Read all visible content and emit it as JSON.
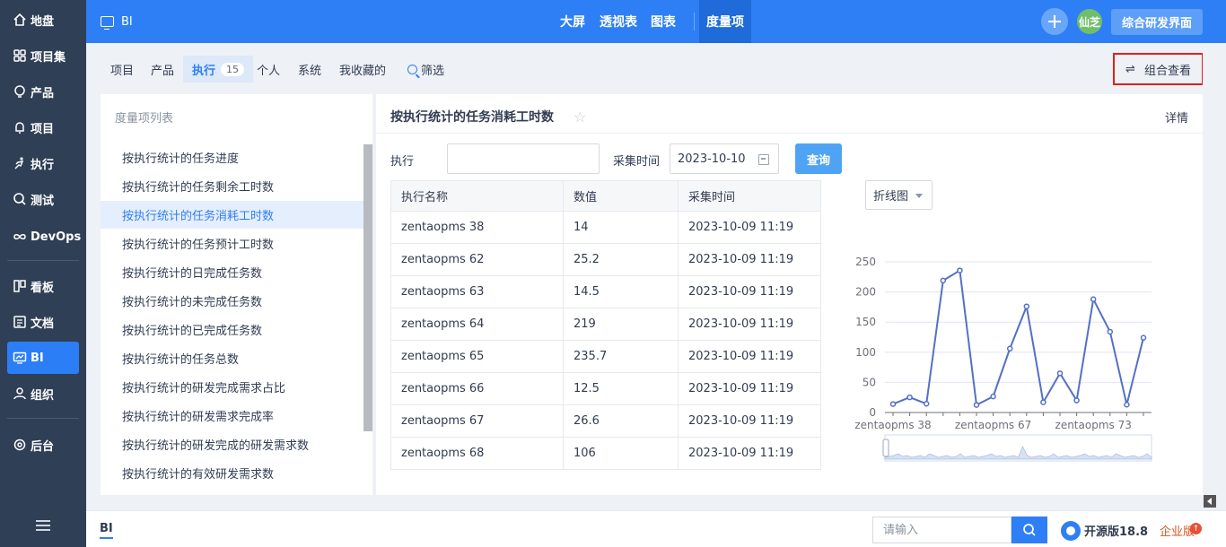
{
  "leftnav": {
    "items": [
      {
        "label": "地盘",
        "icon": "home-icon"
      },
      {
        "label": "项目集",
        "icon": "grid-icon"
      },
      {
        "label": "产品",
        "icon": "bulb-icon"
      },
      {
        "label": "项目",
        "icon": "bell-icon"
      },
      {
        "label": "执行",
        "icon": "run-icon"
      },
      {
        "label": "测试",
        "icon": "search-icon"
      },
      {
        "label": "DevOps",
        "icon": "infinity-icon"
      },
      {
        "label": "看板",
        "icon": "board-icon"
      },
      {
        "label": "文档",
        "icon": "doc-icon"
      },
      {
        "label": "BI",
        "icon": "monitor-icon"
      },
      {
        "label": "组织",
        "icon": "user-icon"
      },
      {
        "label": "后台",
        "icon": "gear-icon"
      }
    ],
    "active": "BI"
  },
  "topbar": {
    "app_title": "BI",
    "nav": [
      "大屏",
      "透视表",
      "图表"
    ],
    "active_nav": "度量项",
    "avatar_text": "仙芝",
    "rd_button": "综合研发界面"
  },
  "subtabs": {
    "items": [
      "项目",
      "产品",
      "执行",
      "个人",
      "系统",
      "我收藏的"
    ],
    "active": "执行",
    "active_count": "15",
    "filter_label": "筛选",
    "combo_label": "组合查看"
  },
  "metric_list": {
    "heading": "度量项列表",
    "items": [
      "按执行统计的任务进度",
      "按执行统计的任务剩余工时数",
      "按执行统计的任务消耗工时数",
      "按执行统计的任务预计工时数",
      "按执行统计的日完成任务数",
      "按执行统计的未完成任务数",
      "按执行统计的已完成任务数",
      "按执行统计的任务总数",
      "按执行统计的研发完成需求占比",
      "按执行统计的研发需求完成率",
      "按执行统计的研发完成的研发需求数",
      "按执行统计的有效研发需求数"
    ],
    "active_index": 2
  },
  "main": {
    "title": "按执行统计的任务消耗工时数",
    "detail_link": "详情",
    "filter_exec_label": "执行",
    "filter_exec_value": "",
    "filter_time_label": "采集时间",
    "filter_time_value": "2023-10-10",
    "query_button": "查询",
    "table": {
      "headers": [
        "执行名称",
        "数值",
        "采集时间"
      ],
      "rows": [
        [
          "zentaopms 38",
          "14",
          "2023-10-09 11:19"
        ],
        [
          "zentaopms 62",
          "25.2",
          "2023-10-09 11:19"
        ],
        [
          "zentaopms 63",
          "14.5",
          "2023-10-09 11:19"
        ],
        [
          "zentaopms 64",
          "219",
          "2023-10-09 11:19"
        ],
        [
          "zentaopms 65",
          "235.7",
          "2023-10-09 11:19"
        ],
        [
          "zentaopms 66",
          "12.5",
          "2023-10-09 11:19"
        ],
        [
          "zentaopms 67",
          "26.6",
          "2023-10-09 11:19"
        ],
        [
          "zentaopms 68",
          "106",
          "2023-10-09 11:19"
        ]
      ]
    },
    "chart_type_select": "折线图"
  },
  "chart_data": {
    "type": "line",
    "title": "",
    "xlabel": "",
    "ylabel": "",
    "ylim": [
      0,
      250
    ],
    "yticks": [
      0,
      50,
      100,
      150,
      200,
      250
    ],
    "x_tick_labels": [
      "zentaopms 38",
      "zentaopms 67",
      "zentaopms 73"
    ],
    "series": [
      {
        "values": [
          14,
          25.2,
          14.5,
          219,
          235.7,
          12.5,
          26.6,
          106,
          176,
          17,
          65,
          20,
          188,
          134,
          13,
          124
        ]
      }
    ],
    "color": "#5470c6",
    "grid": true,
    "has_zoom_slider": true
  },
  "footer": {
    "breadcrumb": "BI",
    "search_placeholder": "请输入",
    "version": "开源版18.8",
    "enterprise": "企业版",
    "ent_badge": "↑"
  }
}
